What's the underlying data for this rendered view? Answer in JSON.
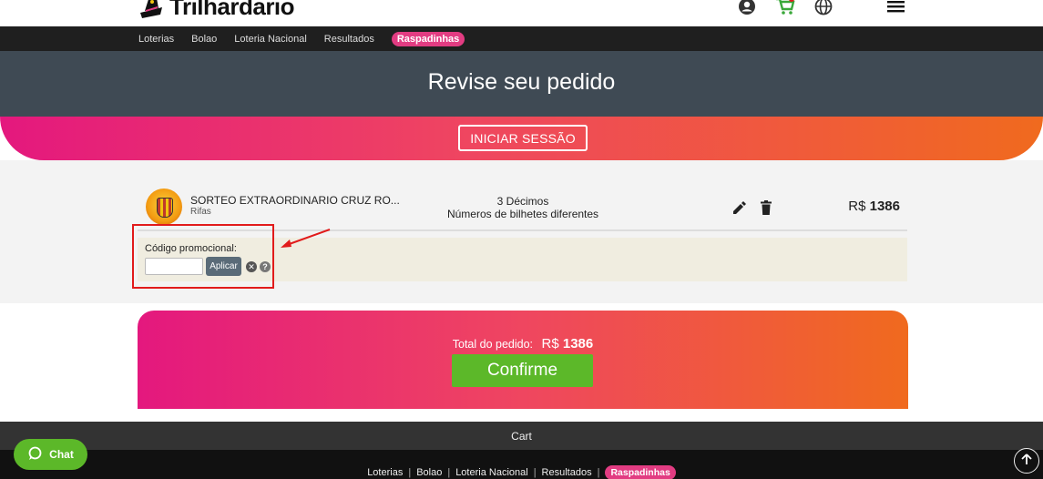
{
  "header": {
    "logo_text": "Trilhardario",
    "icons": [
      "user-icon",
      "cart-icon",
      "globe-icon",
      "menu-icon"
    ]
  },
  "nav": {
    "items": [
      "Loterias",
      "Bolao",
      "Loteria Nacional",
      "Resultados"
    ],
    "highlight_item": "Raspadinhas"
  },
  "page": {
    "title": "Revise seu pedido",
    "login_button": "INICIAR SESSÃO"
  },
  "order": {
    "product_name": "SORTEO EXTRAORDINARIO CRUZ RO...",
    "product_category": "Rifas",
    "quantity_line1": "3 Décimos",
    "quantity_line2": "Números de bilhetes diferentes",
    "price_currency": "R$",
    "price_value": "1386"
  },
  "promo": {
    "label": "Código promocional:",
    "input_value": "",
    "apply_button": "Aplicar",
    "clear_symbol": "✕",
    "help_symbol": "?"
  },
  "total": {
    "label": "Total do pedido:",
    "currency": "R$",
    "value": "1386",
    "confirm_button": "Confirme"
  },
  "cart_bar": {
    "label": "Cart"
  },
  "footer": {
    "links": [
      "Loterias",
      "Bolao",
      "Loteria Nacional",
      "Resultados"
    ],
    "highlight_link": "Raspadinhas"
  },
  "chat": {
    "label": "Chat"
  },
  "colors": {
    "brand_pink": "#e4187e",
    "brand_orange": "#f06a1e",
    "confirm_green": "#5cb829",
    "title_band": "#3f4a54",
    "highlight_red": "#e11b1b"
  }
}
